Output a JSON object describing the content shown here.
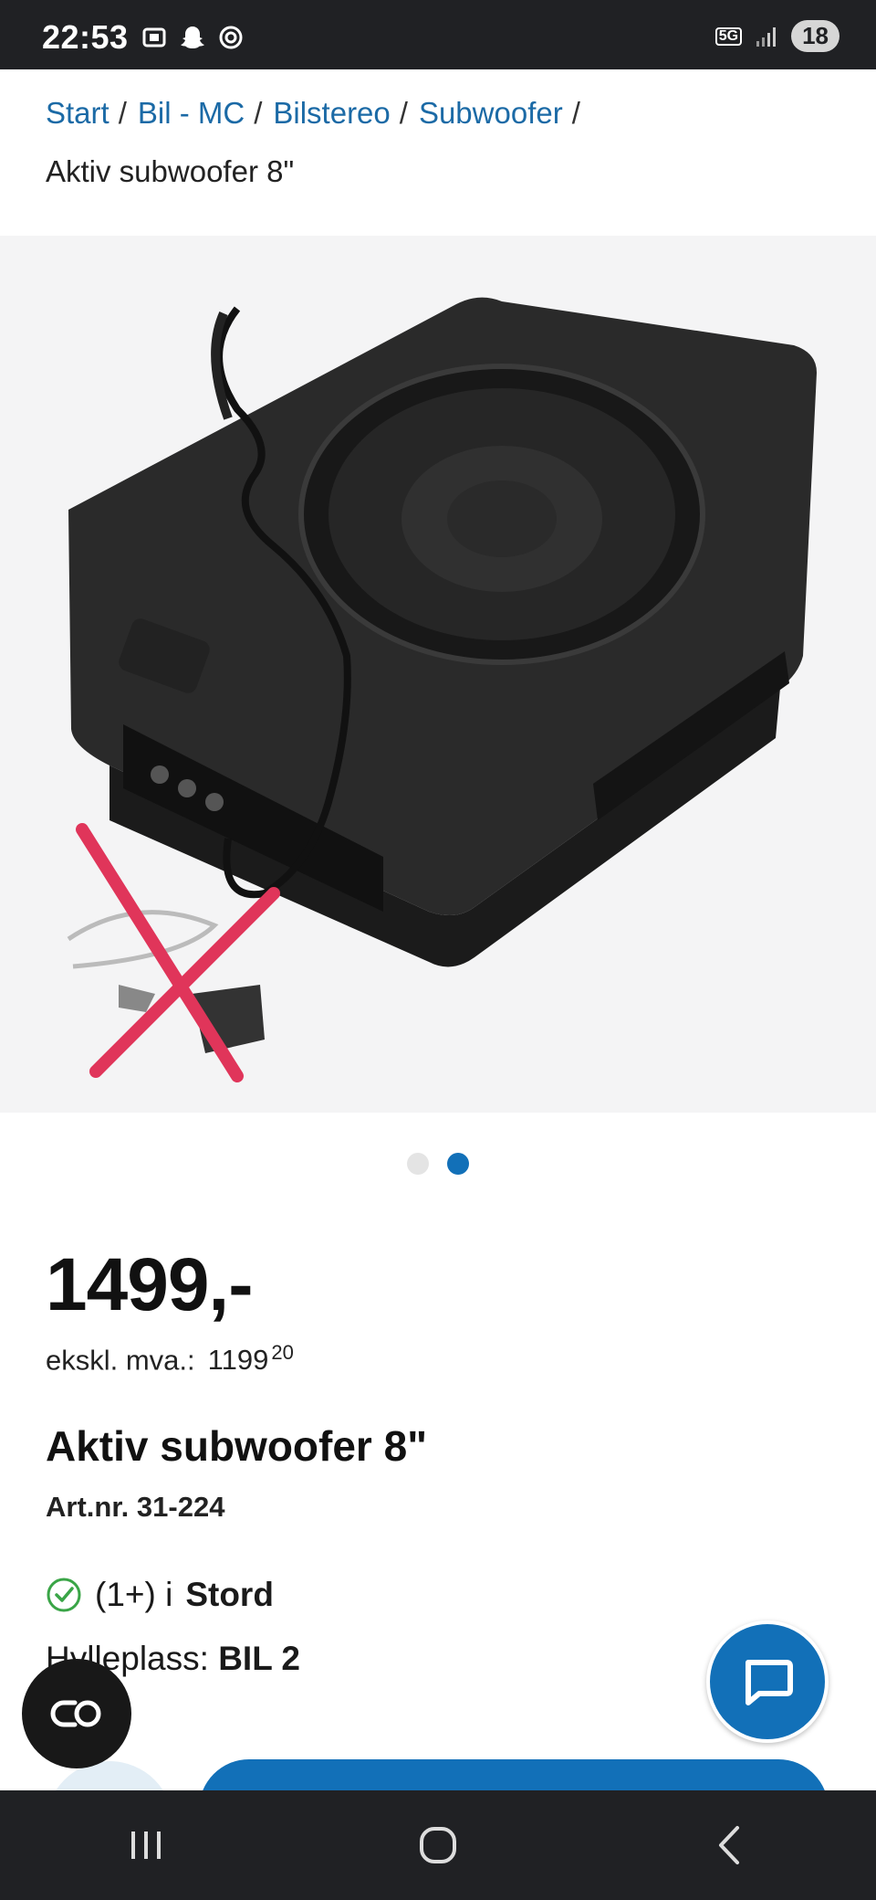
{
  "status_bar": {
    "time": "22:53",
    "network": "5G",
    "battery": "18",
    "icons": [
      "screenshot-icon",
      "snapchat-icon",
      "chatgpt-icon",
      "signal-icon"
    ]
  },
  "breadcrumb": {
    "items": [
      "Start",
      "Bil - MC",
      "Bilstereo",
      "Subwoofer"
    ],
    "separator": "/",
    "current": "Aktiv subwoofer 8\""
  },
  "carousel": {
    "total": 2,
    "active": 2
  },
  "product": {
    "price": "1499,-",
    "ex_vat_label": "ekskl. mva.:",
    "ex_vat_value": "1199",
    "ex_vat_cents": "20",
    "title": "Aktiv subwoofer 8\"",
    "art_nr": "Art.nr. 31-224",
    "stock_text": "(1+) i",
    "stock_store": "Stord",
    "shelf_label": "Hylleplass:",
    "shelf_value": "BIL 2"
  },
  "colors": {
    "accent": "#1270b8",
    "link": "#1b6aa6",
    "stock_ok": "#3aa547",
    "strike": "#e0355a"
  }
}
